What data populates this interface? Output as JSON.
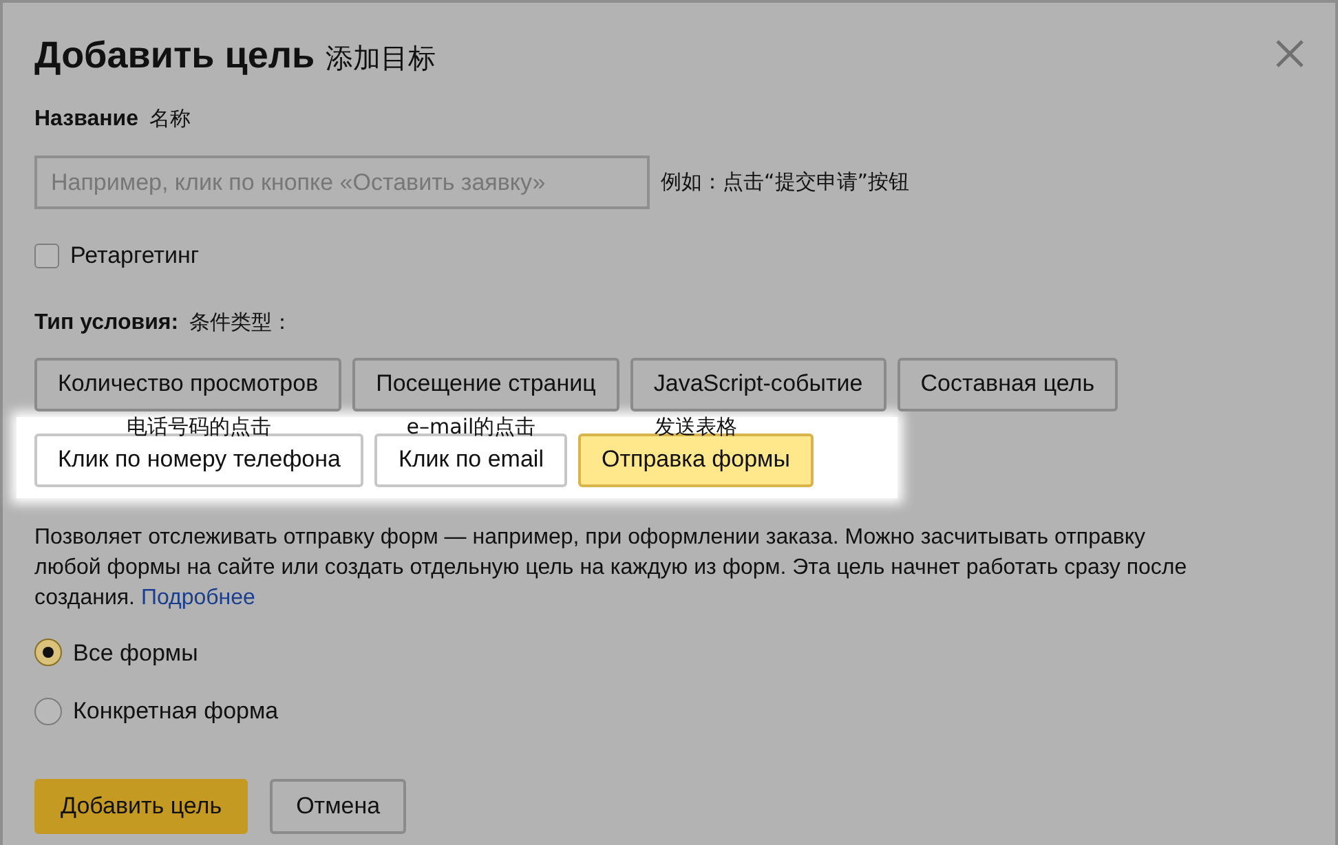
{
  "dialog": {
    "title": "Добавить цель",
    "title_note": "添加目标"
  },
  "name_field": {
    "label": "Название",
    "label_note": "名称",
    "placeholder": "Например, клик по кнопке «Оставить заявку»",
    "note": "例如：点击“提交申请”按钮"
  },
  "retargeting": {
    "label": "Ретаргетинг",
    "checked": false
  },
  "condition_type": {
    "label": "Тип условия:",
    "label_note": "条件类型："
  },
  "condition_rows": [
    {
      "highlighted": false,
      "buttons": [
        {
          "label": "Количество просмотров",
          "selected": false
        },
        {
          "label": "Посещение страниц",
          "selected": false
        },
        {
          "label": "JavaScript-событие",
          "selected": false
        },
        {
          "label": "Составная цель",
          "selected": false
        }
      ]
    },
    {
      "highlighted": true,
      "buttons": [
        {
          "label": "Клик по номеру телефона",
          "note": "电话号码的点击",
          "selected": false
        },
        {
          "label": "Клик по email",
          "note": "e–mail的点击",
          "selected": false
        },
        {
          "label": "Отправка формы",
          "note": "发送表格",
          "selected": true
        }
      ]
    }
  ],
  "description": {
    "text": "Позволяет отслеживать отправку форм — например, при оформлении заказа. Можно засчитывать отправку любой формы на сайте или создать отдельную цель на каждую из форм. Эта цель начнет работать сразу после создания.",
    "link": "Подробнее"
  },
  "form_options": [
    {
      "label": "Все формы",
      "selected": true
    },
    {
      "label": "Конкретная форма",
      "selected": false
    }
  ],
  "buttons": [
    {
      "label": "Добавить цель",
      "kind": "primary"
    },
    {
      "label": "Отмена",
      "kind": "secondary"
    }
  ]
}
